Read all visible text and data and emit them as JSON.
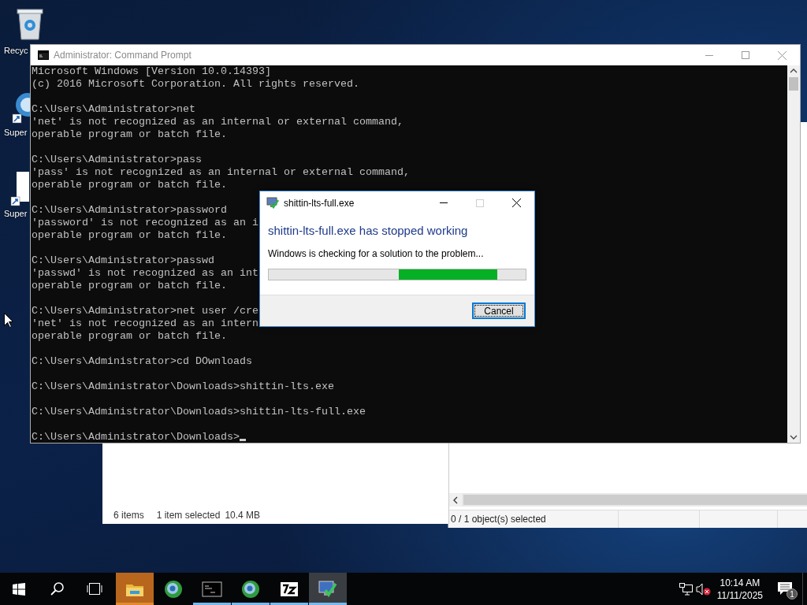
{
  "desktop": {
    "icons": [
      {
        "kind": "recycle-bin",
        "label": "Recyc"
      },
      {
        "kind": "globe-shortcut",
        "label": "Super"
      },
      {
        "kind": "page-shortcut",
        "label": "Super"
      }
    ]
  },
  "explorer_window": {
    "status_items": [
      "6 items",
      "1 item selected",
      "10.4 MB"
    ]
  },
  "object_window": {
    "status": "0 / 1 object(s) selected"
  },
  "console_window": {
    "title": "Administrator: Command Prompt",
    "active": false,
    "cursor_visible": true,
    "blocks": [
      [
        "Microsoft Windows [Version 10.0.14393]",
        "(c) 2016 Microsoft Corporation. All rights reserved."
      ],
      [
        "C:\\Users\\Administrator>net",
        "'net' is not recognized as an internal or external command,",
        "operable program or batch file."
      ],
      [
        "C:\\Users\\Administrator>pass",
        "'pass' is not recognized as an internal or external command,",
        "operable program or batch file."
      ],
      [
        "C:\\Users\\Administrator>password",
        "'password' is not recognized as an i",
        "operable program or batch file."
      ],
      [
        "C:\\Users\\Administrator>passwd",
        "'passwd' is not recognized as an int",
        "operable program or batch file."
      ],
      [
        "C:\\Users\\Administrator>net user /cre",
        "'net' is not recognized as an intern",
        "operable program or batch file."
      ],
      [
        "C:\\Users\\Administrator>cd DOwnloads"
      ],
      [
        "C:\\Users\\Administrator\\Downloads>shittin-lts.exe"
      ],
      [
        "C:\\Users\\Administrator\\Downloads>shittin-lts-full.exe"
      ],
      [
        "C:\\Users\\Administrator\\Downloads>"
      ]
    ]
  },
  "error_dialog": {
    "title": "shittin-lts-full.exe",
    "heading": "shittin-lts-full.exe has stopped working",
    "message": "Windows is checking for a solution to the problem...",
    "maximize_disabled": true,
    "progress": {
      "indeterminate": true
    },
    "buttons": [
      {
        "label": "Cancel",
        "focused": true
      }
    ]
  },
  "taskbar": {
    "apps": [
      {
        "kind": "folder",
        "flashing": true,
        "running": true,
        "selected": false
      },
      {
        "kind": "globe",
        "flashing": false,
        "running": false,
        "selected": false
      },
      {
        "kind": "console",
        "flashing": false,
        "running": true,
        "selected": false
      },
      {
        "kind": "globe",
        "flashing": false,
        "running": true,
        "selected": false
      },
      {
        "kind": "archive",
        "flashing": false,
        "running": true,
        "selected": false
      },
      {
        "kind": "monitor-check",
        "flashing": false,
        "running": true,
        "selected": true
      }
    ],
    "volume_muted": true,
    "clock": {
      "time": "10:14 AM",
      "date": "11/11/2025"
    },
    "notifications": {
      "count": "1"
    }
  }
}
